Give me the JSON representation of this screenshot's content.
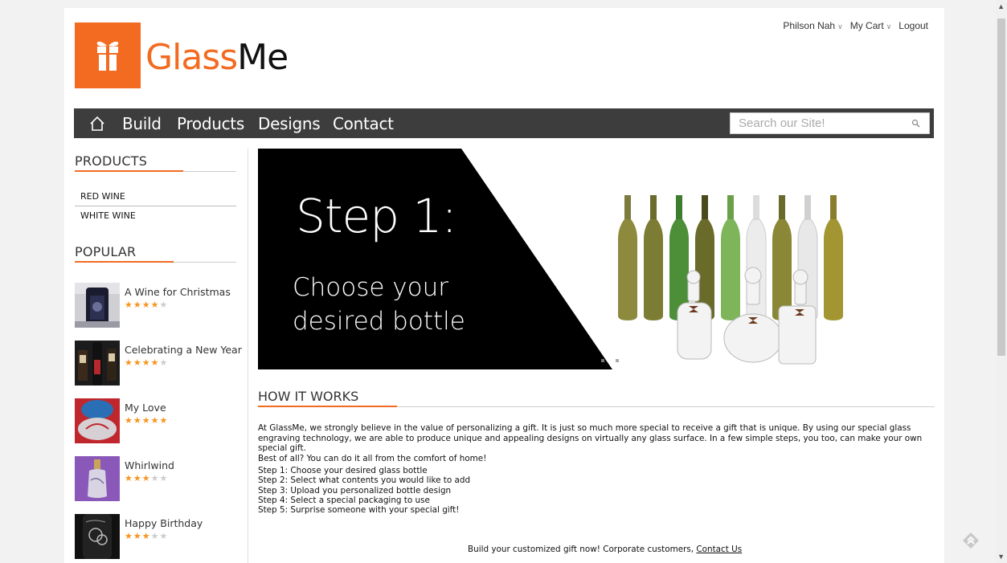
{
  "brand": {
    "name_prefix": "Glass",
    "name_suffix": "Me",
    "accent": "#f26b21"
  },
  "user_links": {
    "user": "Philson Nah",
    "cart": "My Cart",
    "logout": "Logout"
  },
  "nav": {
    "items": [
      "Build",
      "Products",
      "Designs",
      "Contact"
    ],
    "search_placeholder": "Search our Site!"
  },
  "sidebar": {
    "products_heading": "PRODUCTS",
    "products": [
      "RED WINE",
      "WHITE WINE"
    ],
    "popular_heading": "POPULAR",
    "popular": [
      {
        "title": "A Wine for Christmas",
        "rating": 4,
        "out_of": 5
      },
      {
        "title": "Celebrating a New Year",
        "rating": 4,
        "out_of": 5
      },
      {
        "title": "My Love",
        "rating": 5,
        "out_of": 5
      },
      {
        "title": "Whirlwind",
        "rating": 3,
        "out_of": 5
      },
      {
        "title": "Happy Birthday",
        "rating": 3,
        "out_of": 5
      }
    ]
  },
  "banner": {
    "title": "Step 1:",
    "subtitle": "Choose your desired bottle"
  },
  "how_it_works": {
    "heading": "HOW IT WORKS",
    "paragraph": "At GlassMe, we strongly believe in the value of personalizing a gift. It is just so much more special to receive a gift that is unique. By using our special glass engraving technology, we are able to produce unique and appealing designs on virtually any glass surface. In a few simple steps, you too, can make your own special gift.",
    "paragraph_2": "Best of all? You can do it all from the comfort of home!",
    "steps": [
      "Step 1: Choose your desired glass bottle",
      "Step 2: Select what contents you would like to add",
      "Step 3: Upload you personalized bottle design",
      "Step 4: Select a special packaging to use",
      "Step 5: Surprise someone with your special gift!"
    ],
    "cta_text": "Build your customized gift now! Corporate customers, ",
    "cta_link": "Contact Us"
  }
}
